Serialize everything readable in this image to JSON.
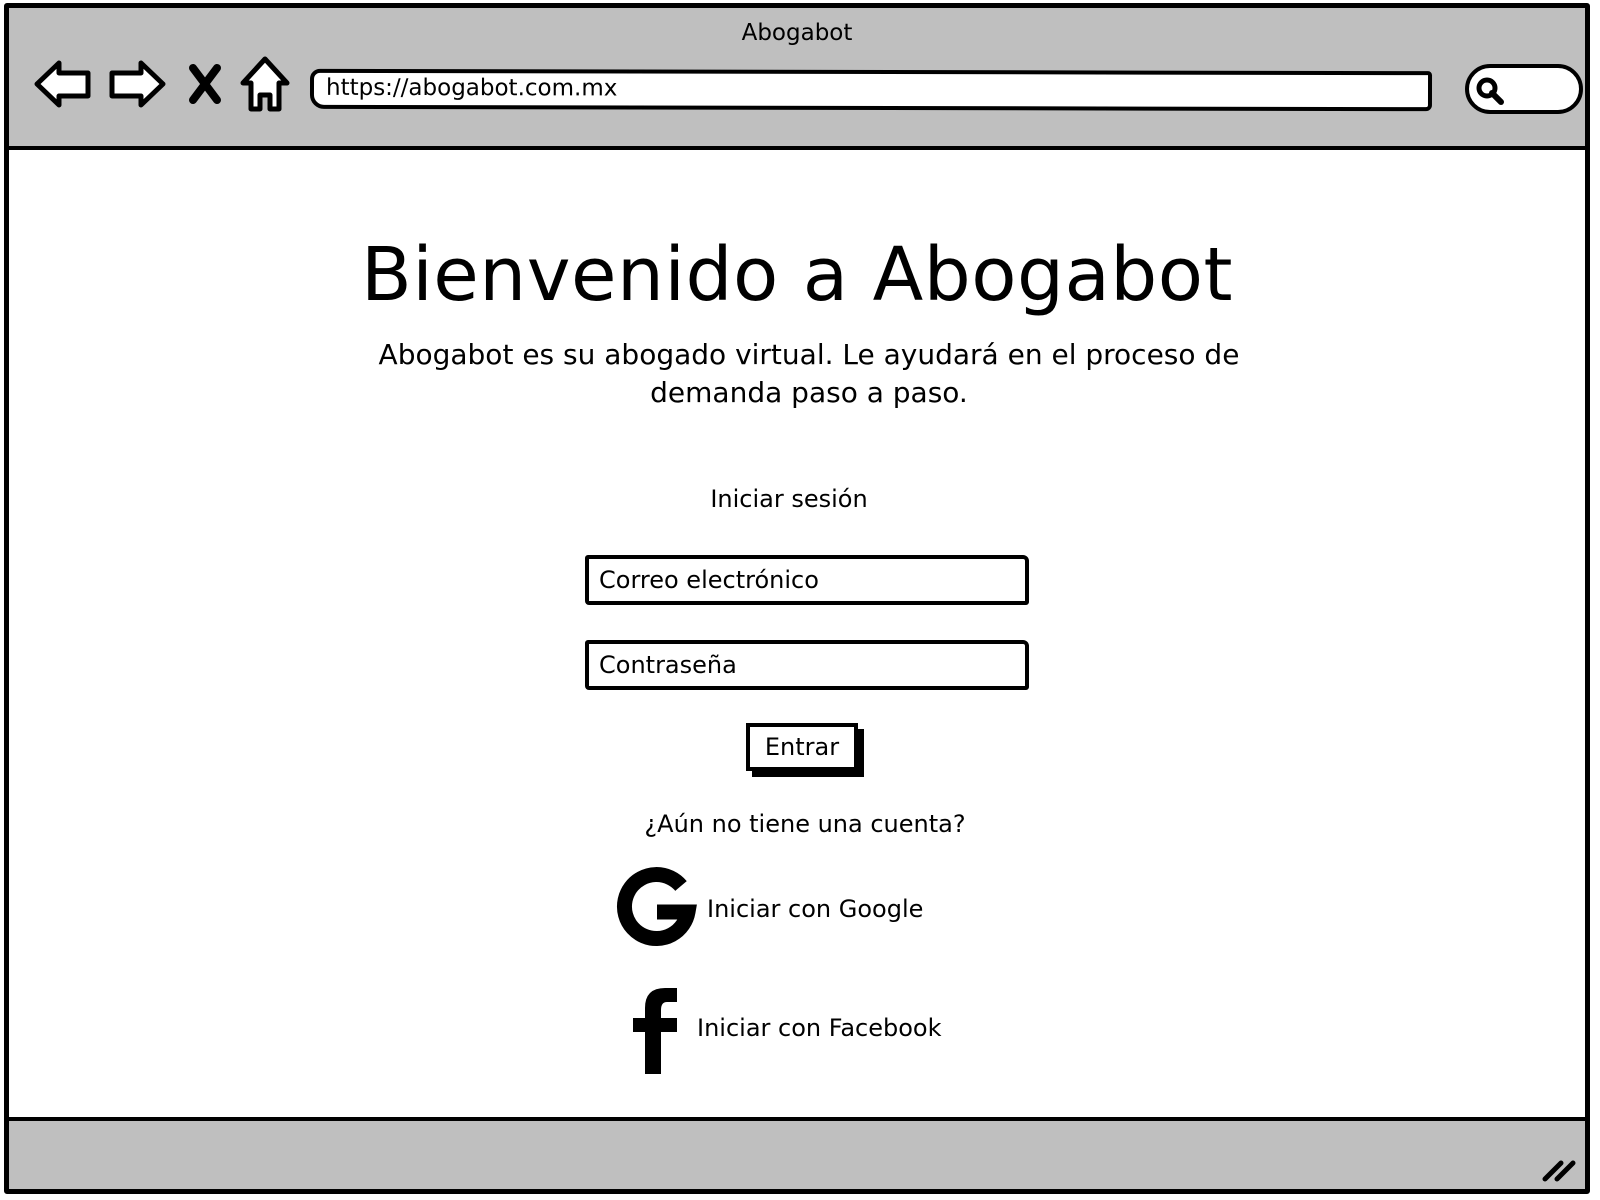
{
  "browser": {
    "window_title": "Abogabot",
    "url": "https://abogabot.com.mx",
    "nav_icons": [
      "back-arrow-icon",
      "forward-arrow-icon",
      "stop-x-icon",
      "home-icon"
    ],
    "search_icon": "search-icon"
  },
  "page": {
    "headline": "Bienvenido a Abogabot",
    "subtitle": "Abogabot es su abogado virtual. Le ayudará en el proceso de demanda paso a paso.",
    "login": {
      "title": "Iniciar sesión",
      "email_placeholder": "Correo electrónico",
      "password_placeholder": "Contraseña",
      "submit_label": "Entrar"
    },
    "signup": {
      "question": "¿Aún no tiene una cuenta?",
      "google_label": "Iniciar con Google",
      "facebook_label": "Iniciar con Facebook"
    }
  },
  "colors": {
    "chrome_gray": "#bfbfbf",
    "stroke": "#000000",
    "background": "#ffffff"
  }
}
